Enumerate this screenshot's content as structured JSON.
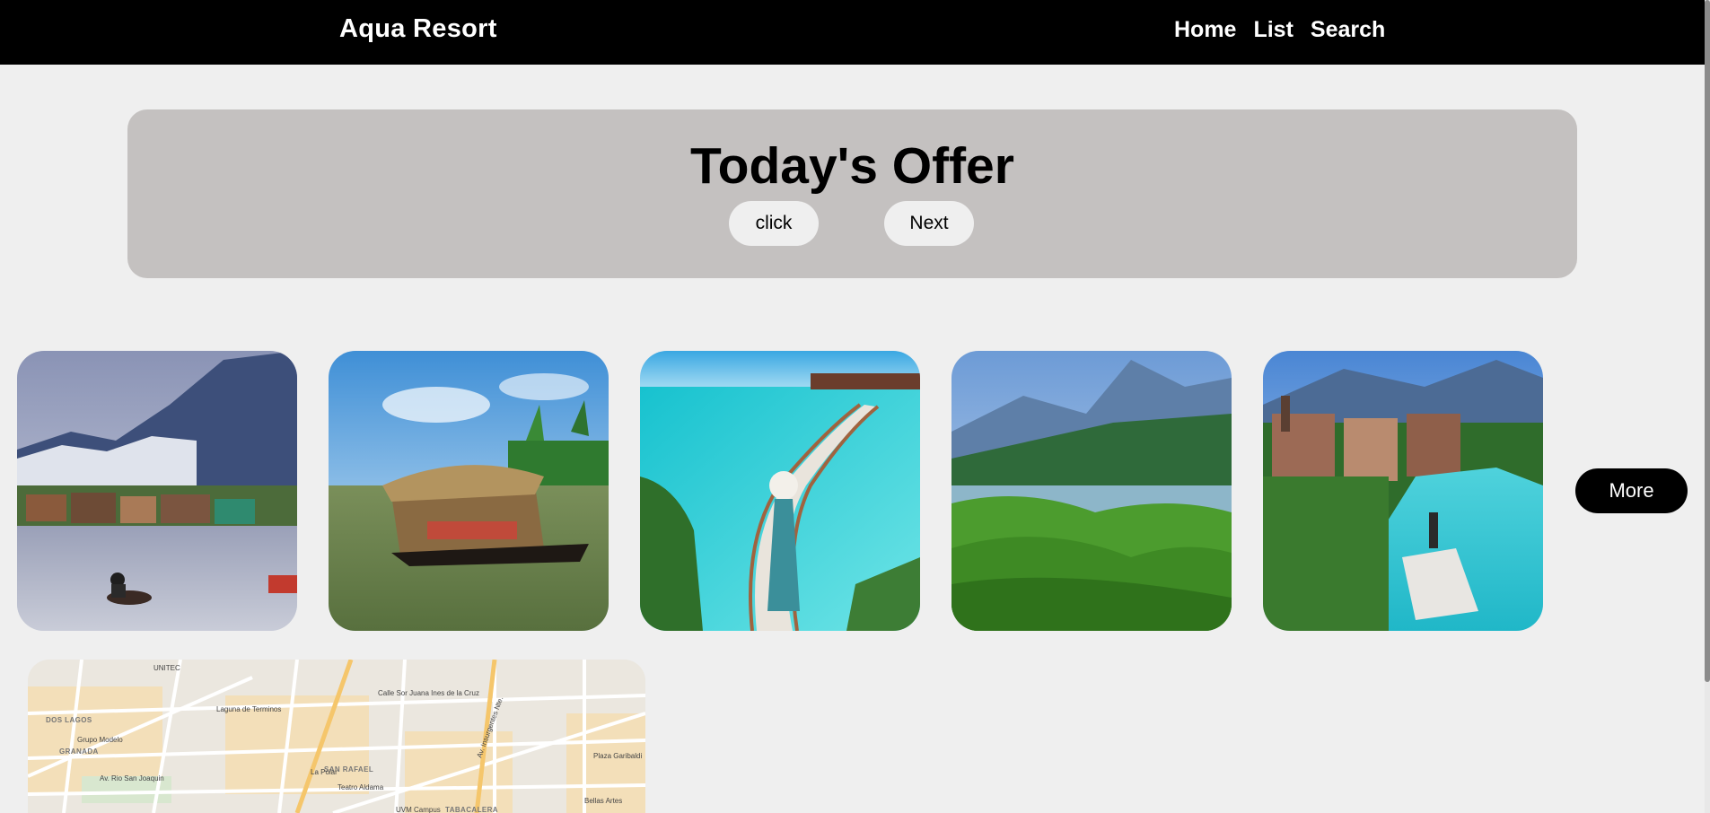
{
  "header": {
    "brand": "Aqua Resort",
    "nav": [
      "Home",
      "List",
      "Search"
    ]
  },
  "offer": {
    "title": "Today's Offer",
    "buttons": {
      "click": "click",
      "next": "Next"
    }
  },
  "gallery": {
    "images": [
      "lake-houseboat-mountains-photo",
      "kerala-houseboat-photo",
      "boardwalk-woman-sea-photo",
      "tea-hills-lake-photo",
      "river-town-boats-photo"
    ],
    "more_label": "More"
  },
  "map": {
    "districts": [
      "DOS LAGOS",
      "GRANADA",
      "SAN RAFAEL",
      "TABACALERA"
    ],
    "places": [
      "Grupo Modelo",
      "Plaza Garibaldi",
      "Teatro Aldama",
      "UVM Campus",
      "La Polar",
      "UNITEC",
      "Av. Rio San Joaquin",
      "Laguna de Terminos",
      "Calle Sor Juana Ines de la Cruz",
      "Av. Insurgentes Nte.",
      "Bellas Artes"
    ]
  },
  "colors": {
    "header_bg": "#000000",
    "page_bg": "#efefef",
    "offer_bg": "#c4c1c0",
    "more_bg": "#000000"
  }
}
